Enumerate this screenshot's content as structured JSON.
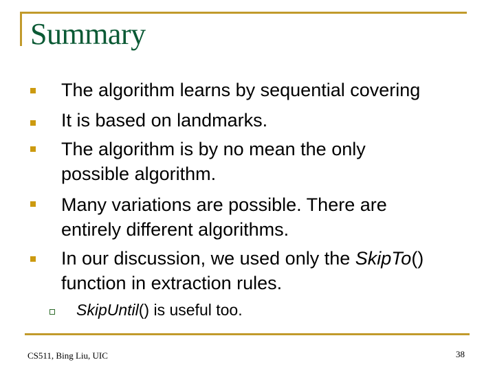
{
  "slide": {
    "title": "Summary",
    "colors": {
      "accent": "#c19a2b",
      "title": "#0b5a35",
      "bullet": "#cc9a10",
      "sub_bullet": "#2e6b2a"
    },
    "bullets": [
      {
        "lines": [
          "The algorithm learns by sequential covering"
        ]
      },
      {
        "lines": [
          "It is based on landmarks."
        ]
      },
      {
        "lines": [
          "The algorithm is by no mean the only",
          "possible algorithm."
        ]
      },
      {
        "lines": [
          "Many variations are possible. There are",
          "entirely different algorithms."
        ]
      },
      {
        "line1_prefix": "In our discussion, we used only the ",
        "line1_italic": "SkipTo",
        "line1_suffix": "()",
        "line2": "function in extraction rules."
      }
    ],
    "sub_bullets": [
      {
        "italic": "SkipUntil",
        "suffix": "() is useful too."
      }
    ],
    "footer": {
      "left": "CS511, Bing Liu, UIC",
      "page_number": "38"
    }
  }
}
